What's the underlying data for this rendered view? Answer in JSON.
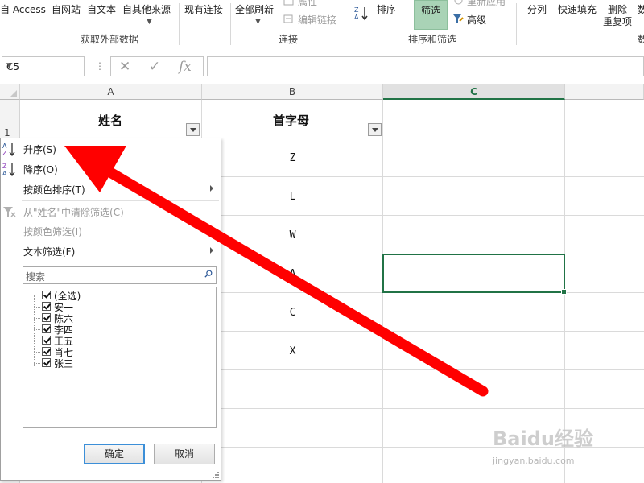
{
  "ribbon": {
    "get_external_data": {
      "from_access": "自 Access",
      "from_web": "自网站",
      "from_text": "自文本",
      "from_other": "自其他来源",
      "existing_connections": "现有连接",
      "group_label": "获取外部数据"
    },
    "connections": {
      "refresh_all": "全部刷新",
      "properties": "属性",
      "edit_links": "编辑链接",
      "group_label": "连接"
    },
    "sort_filter": {
      "sort": "排序",
      "filter": "筛选",
      "reapply": "重新应用",
      "advanced": "高级",
      "group_label": "排序和筛选"
    },
    "data_tools": {
      "text_to_columns": "分列",
      "flash_fill": "快速填充",
      "remove_dup_line1": "删除",
      "remove_dup_line2": "重复项",
      "cut_label": "数"
    }
  },
  "formula_bar": {
    "name_box": "C5",
    "dots": "⋮",
    "cancel": "✕",
    "enter": "✓",
    "fx": "fx",
    "value": ""
  },
  "grid": {
    "columns": [
      "A",
      "B",
      "C"
    ],
    "selected_column": "C",
    "row_numbers": [
      "1"
    ],
    "header_row": {
      "a": "姓名",
      "b": "首字母"
    },
    "col_b_values": [
      "Z",
      "L",
      "W",
      "A",
      "C",
      "X"
    ]
  },
  "filter_menu": {
    "sort_asc": "升序(S)",
    "sort_desc": "降序(O)",
    "sort_by_color": "按颜色排序(T)",
    "clear_filter": "从\"姓名\"中清除筛选(C)",
    "filter_by_color": "按颜色筛选(I)",
    "text_filters": "文本筛选(F)",
    "search_placeholder": "搜索",
    "items": [
      "(全选)",
      "安一",
      "陈六",
      "李四",
      "王五",
      "肖七",
      "张三"
    ],
    "ok": "确定",
    "cancel": "取消"
  },
  "watermark": {
    "brand": "Baidu经验",
    "url": "jingyan.baidu.com"
  },
  "colors": {
    "excel_green": "#217346",
    "filter_active_bg": "#a9d3b6",
    "arrow_red": "#ff0000"
  }
}
